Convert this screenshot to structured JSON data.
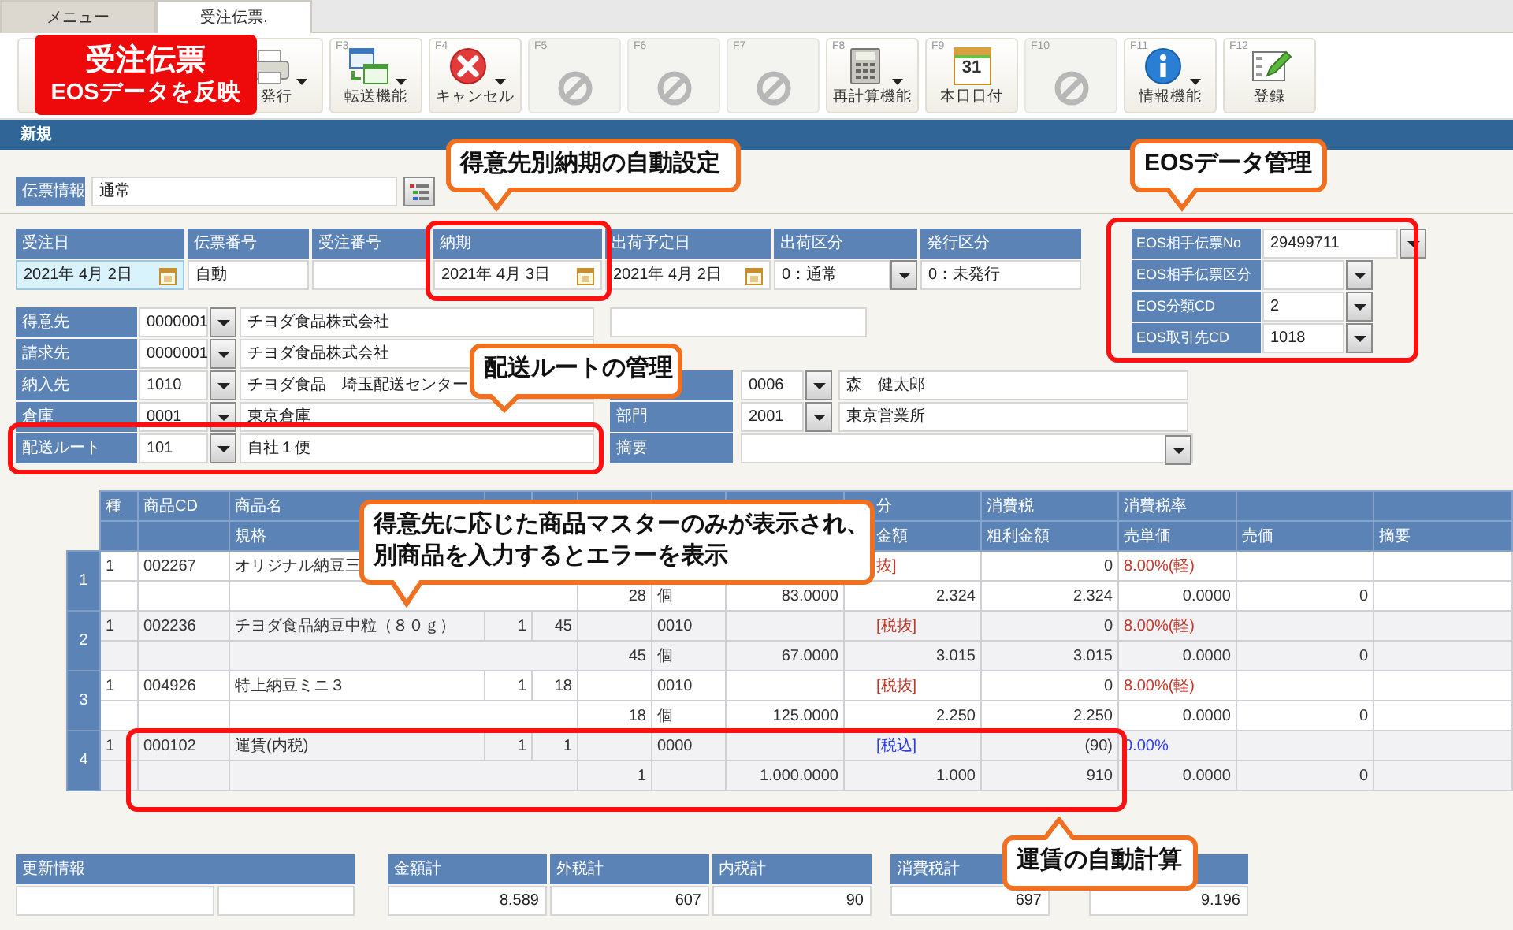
{
  "tabs": [
    {
      "label": "メニュー",
      "selected": false
    },
    {
      "label": "受注伝票.",
      "selected": true
    }
  ],
  "toolbar": [
    {
      "disabled": false
    },
    {
      "label": "発行",
      "disabled": false,
      "dropdown": true
    },
    {
      "fkey": "F3",
      "label": "転送機能",
      "disabled": false,
      "dropdown": true
    },
    {
      "fkey": "F4",
      "label": "キャンセル",
      "disabled": false,
      "dropdown": true
    },
    {
      "fkey": "F5",
      "disabled": true,
      "dropdown": false
    },
    {
      "fkey": "F6",
      "disabled": true,
      "dropdown": false
    },
    {
      "fkey": "F7",
      "disabled": true,
      "dropdown": false
    },
    {
      "fkey": "F8",
      "label": "再計算機能",
      "disabled": false,
      "dropdown": true
    },
    {
      "fkey": "F9",
      "label": "本日日付",
      "icon_text": "31",
      "disabled": false,
      "dropdown": false
    },
    {
      "fkey": "F10",
      "disabled": true,
      "dropdown": false
    },
    {
      "fkey": "F11",
      "label": "情報機能",
      "disabled": false,
      "dropdown": true
    },
    {
      "fkey": "F12",
      "label": "登録",
      "disabled": false,
      "dropdown": false
    }
  ],
  "mode": "新規",
  "slip_info": {
    "label": "伝票情報",
    "value": "通常"
  },
  "header_fields": [
    {
      "label": "受注日",
      "value": "2021年 4月 2日",
      "kind": "date",
      "focused": true
    },
    {
      "label": "伝票番号",
      "value": "自動",
      "kind": "text",
      "focused": false
    },
    {
      "label": "受注番号",
      "kind": "text",
      "focused": false
    },
    {
      "label": "納期",
      "value": "2021年 4月 3日",
      "kind": "date",
      "focused": false
    },
    {
      "label": "出荷予定日",
      "value": "2021年 4月 2日",
      "kind": "date",
      "focused": false
    },
    {
      "label": "出荷区分",
      "value": "0：通常",
      "kind": "select",
      "focused": false
    },
    {
      "label": "発行区分",
      "value": "0：未発行",
      "kind": "text",
      "focused": false
    }
  ],
  "eos_fields": [
    {
      "label": "EOS相手伝票No",
      "value": "29499711"
    },
    {
      "label": "EOS相手伝票区分"
    },
    {
      "label": "EOS分類CD",
      "value": "2"
    },
    {
      "label": "EOS取引先CD",
      "value": "1018"
    }
  ],
  "party_fields": [
    {
      "label": "得意先",
      "code": "0000001",
      "name": "チヨダ食品株式会社",
      "extra_field": true
    },
    {
      "label": "請求先",
      "code": "0000001",
      "name": "チヨダ食品株式会社",
      "extra_field": false
    },
    {
      "label": "納入先",
      "code": "1010",
      "name": "チヨダ食品　埼玉配送センター",
      "extra_field": false
    },
    {
      "label": "倉庫",
      "code": "0001",
      "name": "東京倉庫",
      "extra_field": false
    },
    {
      "label": "配送ルート",
      "code": "101",
      "name": "自社１便",
      "extra_field": false
    }
  ],
  "side_fields": [
    {
      "code": "0006",
      "name": "森　健太郎",
      "kind": "lookup"
    },
    {
      "label": "部門",
      "code": "2001",
      "name": "東京営業所",
      "kind": "lookup"
    },
    {
      "label": "摘要",
      "kind": "select"
    }
  ],
  "table": {
    "header_rows": [
      {
        "type": "種",
        "code": "商品CD",
        "name": "商品名",
        "tax_class": "分",
        "tax": "消費税",
        "tax_rate": "消費税率"
      },
      {
        "spec": "規格",
        "amount": "金額",
        "gross_profit": "粗利金額",
        "unit_price": "売単価",
        "price": "売価",
        "note": "摘要"
      }
    ],
    "rows": [
      {
        "no": "1",
        "kind": "excluded",
        "line1": {
          "type": "1",
          "code": "002267",
          "name": "オリジナル納豆三",
          "tax_class": "抜]",
          "tax": "0",
          "tax_rate": "8.00%(軽)"
        },
        "line2": {
          "column_6": "28",
          "column_7": "個",
          "column_8": "83.0000",
          "amount": "2.324",
          "gross_profit": "2.324",
          "unit_price": "0.0000",
          "price": "0"
        }
      },
      {
        "no": "2",
        "kind": "excluded",
        "line1": {
          "type": "1",
          "code": "002236",
          "name": "チヨダ食品納豆中粒（８０ｇ）",
          "column_4": "1",
          "column_5": "45",
          "column_7": "0010",
          "tax_class": "[税抜]",
          "tax": "0",
          "tax_rate": "8.00%(軽)"
        },
        "line2": {
          "column_6": "45",
          "column_7": "個",
          "column_8": "67.0000",
          "amount": "3.015",
          "gross_profit": "3.015",
          "unit_price": "0.0000",
          "price": "0"
        }
      },
      {
        "no": "3",
        "kind": "excluded",
        "line1": {
          "type": "1",
          "code": "004926",
          "name": "特上納豆ミニ３",
          "column_4": "1",
          "column_5": "18",
          "column_7": "0010",
          "tax_class": "[税抜]",
          "tax": "0",
          "tax_rate": "8.00%(軽)"
        },
        "line2": {
          "column_6": "18",
          "column_7": "個",
          "column_8": "125.0000",
          "amount": "2.250",
          "gross_profit": "2.250",
          "unit_price": "0.0000",
          "price": "0"
        }
      },
      {
        "no": "4",
        "kind": "included",
        "line1": {
          "type": "1",
          "code": "000102",
          "name": "運賃(内税)",
          "column_4": "1",
          "column_5": "1",
          "column_7": "0000",
          "tax_class": "[税込]",
          "tax": "(90)",
          "tax_rate": "0.00%"
        },
        "line2": {
          "column_6": "1",
          "column_8": "1.000.0000",
          "amount": "1.000",
          "gross_profit": "910",
          "unit_price": "0.0000",
          "price": "0"
        }
      }
    ]
  },
  "update_info": {
    "label": "更新情報"
  },
  "totals": [
    {
      "label": "金額計",
      "value": "8.589"
    },
    {
      "label": "外税計",
      "value": "607"
    },
    {
      "label": "内税計",
      "value": "90"
    },
    {
      "label": "消費税計",
      "value": "697"
    },
    {
      "value": "9.196"
    }
  ],
  "annotations": [
    {
      "kind": "banner",
      "lines": [
        "受注伝票",
        "EOSデータを反映"
      ]
    },
    {
      "kind": "callout",
      "lines": [
        "得意先別納期の自動設定"
      ]
    },
    {
      "kind": "callout",
      "lines": [
        "EOSデータ管理"
      ]
    },
    {
      "kind": "callout",
      "lines": [
        "配送ルートの管理"
      ]
    },
    {
      "kind": "callout",
      "lines": [
        "得意先に応じた商品マスターのみが表示され、",
        "別商品を入力するとエラーを表示"
      ]
    },
    {
      "kind": "callout",
      "lines": [
        "運賃の自動計算"
      ]
    }
  ]
}
